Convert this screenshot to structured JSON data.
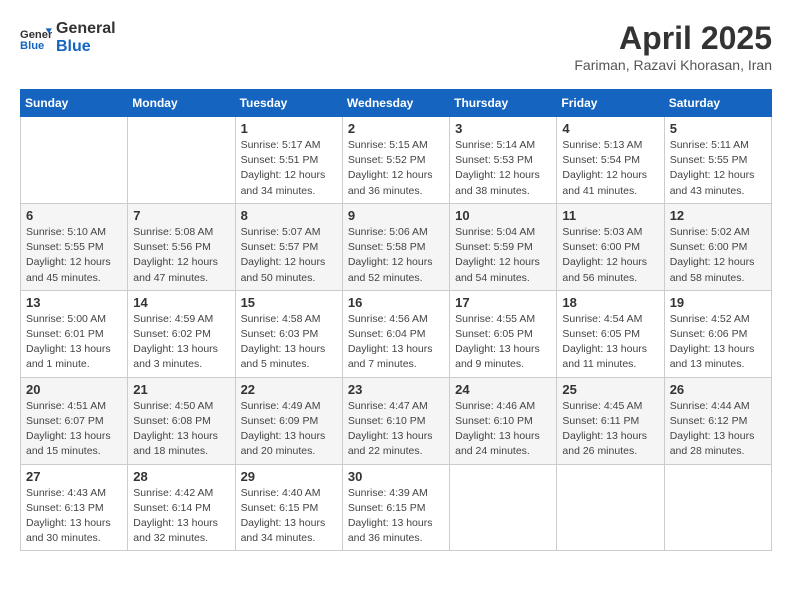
{
  "header": {
    "logo_line1": "General",
    "logo_line2": "Blue",
    "month_title": "April 2025",
    "subtitle": "Fariman, Razavi Khorasan, Iran"
  },
  "weekdays": [
    "Sunday",
    "Monday",
    "Tuesday",
    "Wednesday",
    "Thursday",
    "Friday",
    "Saturday"
  ],
  "weeks": [
    [
      null,
      null,
      {
        "day": 1,
        "sunrise": "5:17 AM",
        "sunset": "5:51 PM",
        "daylight": "12 hours and 34 minutes."
      },
      {
        "day": 2,
        "sunrise": "5:15 AM",
        "sunset": "5:52 PM",
        "daylight": "12 hours and 36 minutes."
      },
      {
        "day": 3,
        "sunrise": "5:14 AM",
        "sunset": "5:53 PM",
        "daylight": "12 hours and 38 minutes."
      },
      {
        "day": 4,
        "sunrise": "5:13 AM",
        "sunset": "5:54 PM",
        "daylight": "12 hours and 41 minutes."
      },
      {
        "day": 5,
        "sunrise": "5:11 AM",
        "sunset": "5:55 PM",
        "daylight": "12 hours and 43 minutes."
      }
    ],
    [
      {
        "day": 6,
        "sunrise": "5:10 AM",
        "sunset": "5:55 PM",
        "daylight": "12 hours and 45 minutes."
      },
      {
        "day": 7,
        "sunrise": "5:08 AM",
        "sunset": "5:56 PM",
        "daylight": "12 hours and 47 minutes."
      },
      {
        "day": 8,
        "sunrise": "5:07 AM",
        "sunset": "5:57 PM",
        "daylight": "12 hours and 50 minutes."
      },
      {
        "day": 9,
        "sunrise": "5:06 AM",
        "sunset": "5:58 PM",
        "daylight": "12 hours and 52 minutes."
      },
      {
        "day": 10,
        "sunrise": "5:04 AM",
        "sunset": "5:59 PM",
        "daylight": "12 hours and 54 minutes."
      },
      {
        "day": 11,
        "sunrise": "5:03 AM",
        "sunset": "6:00 PM",
        "daylight": "12 hours and 56 minutes."
      },
      {
        "day": 12,
        "sunrise": "5:02 AM",
        "sunset": "6:00 PM",
        "daylight": "12 hours and 58 minutes."
      }
    ],
    [
      {
        "day": 13,
        "sunrise": "5:00 AM",
        "sunset": "6:01 PM",
        "daylight": "13 hours and 1 minute."
      },
      {
        "day": 14,
        "sunrise": "4:59 AM",
        "sunset": "6:02 PM",
        "daylight": "13 hours and 3 minutes."
      },
      {
        "day": 15,
        "sunrise": "4:58 AM",
        "sunset": "6:03 PM",
        "daylight": "13 hours and 5 minutes."
      },
      {
        "day": 16,
        "sunrise": "4:56 AM",
        "sunset": "6:04 PM",
        "daylight": "13 hours and 7 minutes."
      },
      {
        "day": 17,
        "sunrise": "4:55 AM",
        "sunset": "6:05 PM",
        "daylight": "13 hours and 9 minutes."
      },
      {
        "day": 18,
        "sunrise": "4:54 AM",
        "sunset": "6:05 PM",
        "daylight": "13 hours and 11 minutes."
      },
      {
        "day": 19,
        "sunrise": "4:52 AM",
        "sunset": "6:06 PM",
        "daylight": "13 hours and 13 minutes."
      }
    ],
    [
      {
        "day": 20,
        "sunrise": "4:51 AM",
        "sunset": "6:07 PM",
        "daylight": "13 hours and 15 minutes."
      },
      {
        "day": 21,
        "sunrise": "4:50 AM",
        "sunset": "6:08 PM",
        "daylight": "13 hours and 18 minutes."
      },
      {
        "day": 22,
        "sunrise": "4:49 AM",
        "sunset": "6:09 PM",
        "daylight": "13 hours and 20 minutes."
      },
      {
        "day": 23,
        "sunrise": "4:47 AM",
        "sunset": "6:10 PM",
        "daylight": "13 hours and 22 minutes."
      },
      {
        "day": 24,
        "sunrise": "4:46 AM",
        "sunset": "6:10 PM",
        "daylight": "13 hours and 24 minutes."
      },
      {
        "day": 25,
        "sunrise": "4:45 AM",
        "sunset": "6:11 PM",
        "daylight": "13 hours and 26 minutes."
      },
      {
        "day": 26,
        "sunrise": "4:44 AM",
        "sunset": "6:12 PM",
        "daylight": "13 hours and 28 minutes."
      }
    ],
    [
      {
        "day": 27,
        "sunrise": "4:43 AM",
        "sunset": "6:13 PM",
        "daylight": "13 hours and 30 minutes."
      },
      {
        "day": 28,
        "sunrise": "4:42 AM",
        "sunset": "6:14 PM",
        "daylight": "13 hours and 32 minutes."
      },
      {
        "day": 29,
        "sunrise": "4:40 AM",
        "sunset": "6:15 PM",
        "daylight": "13 hours and 34 minutes."
      },
      {
        "day": 30,
        "sunrise": "4:39 AM",
        "sunset": "6:15 PM",
        "daylight": "13 hours and 36 minutes."
      },
      null,
      null,
      null
    ]
  ],
  "labels": {
    "sunrise": "Sunrise:",
    "sunset": "Sunset:",
    "daylight": "Daylight:"
  }
}
